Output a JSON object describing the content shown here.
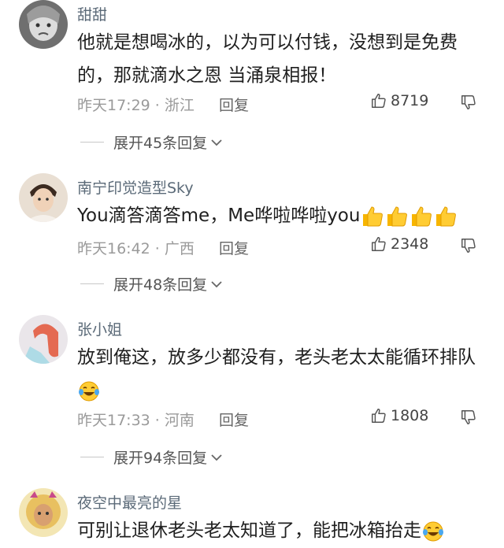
{
  "comments": [
    {
      "username": "甜甜",
      "text": "他就是想喝冰的，以为可以付钱，没想到是免费的，那就滴水之恩 当涌泉相报！",
      "time": "昨天17:29",
      "location": "浙江",
      "reply_label": "回复",
      "likes": "8719",
      "expand_label": "展开45条回复"
    },
    {
      "username": "南宁印觉造型Sky",
      "text": "You滴答滴答me，Me哗啦哗啦you",
      "emoji": [
        "thumbs-up-icon",
        "thumbs-up-icon",
        "thumbs-up-icon",
        "thumbs-up-icon"
      ],
      "time": "昨天16:42",
      "location": "广西",
      "reply_label": "回复",
      "likes": "2348",
      "expand_label": "展开48条回复"
    },
    {
      "username": "张小姐",
      "text": "放到俺这，放多少都没有，老头老太太能循环排队",
      "emoji": [
        "laughing-tears-icon"
      ],
      "time": "昨天17:33",
      "location": "河南",
      "reply_label": "回复",
      "likes": "1808",
      "expand_label": "展开94条回复"
    },
    {
      "username": "夜空中最亮的星",
      "text": "可别让退休老头老太知道了，能把冰箱抬走",
      "emoji": [
        "laughing-tears-icon"
      ]
    }
  ],
  "separator": " · ",
  "colors": {
    "username": "#5b6a78",
    "meta": "#9a9a9a",
    "text": "#1f1f1f",
    "emoji_yellow": "#f7b500"
  }
}
